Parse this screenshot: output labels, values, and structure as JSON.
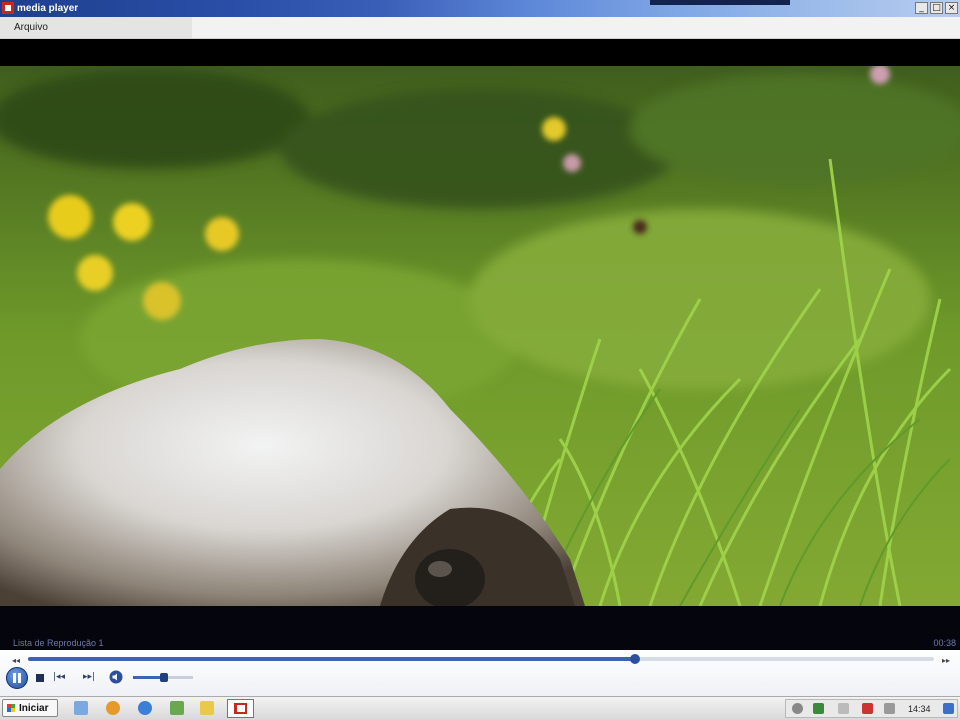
{
  "window": {
    "title": "media player",
    "controls": {
      "minimize": "_",
      "maximize": "□",
      "close": "×"
    }
  },
  "menu": {
    "items": [
      "Arquivo"
    ]
  },
  "playlist": {
    "name": "Lista de Reprodução 1",
    "elapsed": "00:38"
  },
  "seek": {
    "progress": 0.67,
    "start_label": "◂◂",
    "end_label": "▸▸"
  },
  "controls": {
    "prev_label": "|◂◂",
    "next_label": "▸▸|",
    "volume": 0.52
  },
  "taskbar": {
    "start_label": "Iniciar",
    "clock": "14:34"
  },
  "colors": {
    "accent": "#3a64b4",
    "titlebar": "#1f3f8e",
    "video_bg": "#000000"
  },
  "icons": [
    "media-player-app-icon",
    "pause-icon",
    "stop-icon",
    "previous-icon",
    "next-icon",
    "volume-icon",
    "windows-logo-icon"
  ]
}
